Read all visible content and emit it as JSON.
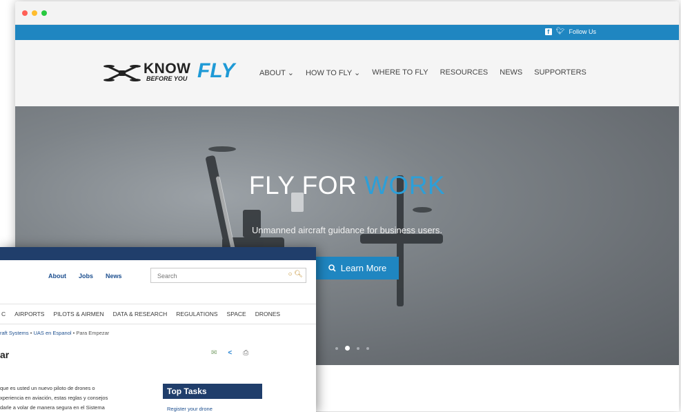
{
  "kbyf": {
    "follow_label": "Follow Us",
    "logo": {
      "know": "KNOW",
      "fly": "FLY",
      "sub": "BEFORE YOU"
    },
    "nav": [
      "ABOUT ⌄",
      "HOW TO FLY ⌄",
      "WHERE TO FLY",
      "RESOURCES",
      "NEWS",
      "SUPPORTERS"
    ],
    "hero": {
      "title_plain": "FLY FOR ",
      "title_accent": "WORK",
      "subtitle": "Unmanned aircraft guidance for business users.",
      "button_label": "Learn More",
      "carousel_slides": 4,
      "carousel_active": 2
    },
    "colors": {
      "brand_blue": "#1f86c1",
      "accent_blue": "#2d9fd8"
    }
  },
  "faa": {
    "util_links": [
      "About",
      "Jobs",
      "News"
    ],
    "search_placeholder": "Search",
    "nav": [
      "C",
      "AIRPORTS",
      "PILOTS & AIRMEN",
      "DATA & RESEARCH",
      "REGULATIONS",
      "SPACE",
      "DRONES"
    ],
    "breadcrumb": [
      "raft Systems",
      "UAS en Espanol",
      "Para Empezar"
    ],
    "page_title": "ar",
    "body_lines": [
      "que es usted un nuevo piloto de drones o",
      "xperiencia en aviación, estas reglas y consejos",
      "darle a volar de manera segura en el Sistema"
    ],
    "top_tasks": {
      "heading": "Top Tasks",
      "item": "Register your drone"
    },
    "colors": {
      "navy": "#203e6b",
      "link": "#1d4f8f"
    }
  }
}
